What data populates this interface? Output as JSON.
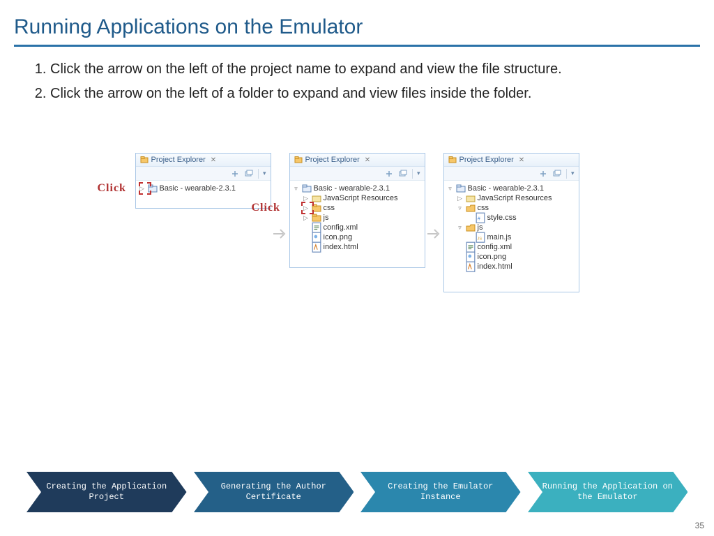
{
  "title": "Running Applications on the Emulator",
  "instructions": [
    "Click the arrow on the left of the project name to expand and view the file structure.",
    "Click the arrow on the left of a folder to expand and view files inside the folder."
  ],
  "panels": {
    "tabLabel": "Project Explorer",
    "panel1": {
      "project": "Basic - wearable-2.3.1"
    },
    "panel2": {
      "project": "Basic - wearable-2.3.1",
      "items": [
        "JavaScript Resources",
        "css",
        "js",
        "config.xml",
        "icon.png",
        "index.html"
      ]
    },
    "panel3": {
      "project": "Basic - wearable-2.3.1",
      "items": [
        "JavaScript Resources",
        "css"
      ],
      "cssChildren": [
        "style.css"
      ],
      "jsLabel": "js",
      "jsChildren": [
        "main.js"
      ],
      "rest": [
        "config.xml",
        "icon.png",
        "index.html"
      ]
    }
  },
  "clickLabel": "Click",
  "steps": [
    "Creating the Application Project",
    "Generating the Author Certificate",
    "Creating the Emulator Instance",
    "Running the Application on the Emulator"
  ],
  "pageNumber": "35",
  "colors": {
    "title": "#1f5a8a",
    "accent": "#2a72a8",
    "click": "#b03030"
  }
}
